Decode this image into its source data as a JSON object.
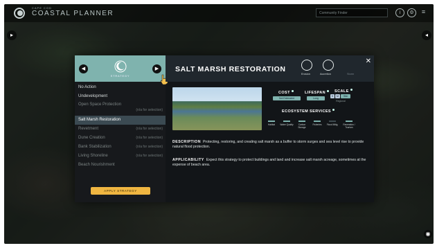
{
  "app": {
    "logo_small": "CAPE COD",
    "logo_big": "COASTAL PLANNER",
    "search_placeholder": "Community Finder",
    "header_icons": [
      "info-icon",
      "settings-icon",
      "menu-icon"
    ]
  },
  "modal": {
    "strategy_label": "STRATEGY",
    "title": "SALT MARSH RESTORATION",
    "header_icons": [
      {
        "icon": "erosion-icon",
        "label": "Erosion"
      },
      {
        "icon": "accretion-icon",
        "label": "Accretion"
      },
      {
        "icon": "storm-icon",
        "label": "Storm"
      }
    ],
    "strategies": [
      {
        "label": "No Action",
        "note": ""
      },
      {
        "label": "Undevelopment",
        "note": ""
      },
      {
        "label": "Open Space Protection",
        "note": "(n/a for selection)"
      },
      {
        "label": "Salt Marsh Restoration",
        "note": "",
        "selected": true
      },
      {
        "label": "Revetment",
        "note": "(n/a for selection)"
      },
      {
        "label": "Dune Creation",
        "note": "(n/a for selection)"
      },
      {
        "label": "Bank Stabilization",
        "note": "(n/a for selection)"
      },
      {
        "label": "Living Shoreline",
        "note": "(n/a for selection)"
      },
      {
        "label": "Beach Nourishment",
        "note": ""
      }
    ],
    "apply_label": "APPLY STRATEGY",
    "stats": {
      "cost_label": "COST",
      "cost_value": "Not Estimated",
      "lifespan_label": "LIFESPAN",
      "lifespan_value": "Long",
      "scale_label": "SCALE",
      "scale_values": [
        "S",
        "M",
        "Site",
        "Regional"
      ],
      "ecosystem_label": "ECOSYSTEM SERVICES",
      "ecosystem_items": [
        "Habitat",
        "Water Quality",
        "Carbon Storage",
        "Fisheries",
        "Flood Mitig.",
        "Recreation / Tourism"
      ]
    },
    "description_label": "DESCRIPTION",
    "description_text": "Protecting, restoring, and creating salt marsh as a buffer to storm surges and sea level rise to provide natural flood protection.",
    "applicability_label": "APPLICABILITY",
    "applicability_text": "Expect this strategy to protect buildings and land and increase salt marsh acreage, sometimes at the expense of beach area."
  },
  "colors": {
    "accent": "#7fb3ae",
    "apply_button": "#f0b641",
    "selected_row": "#3b4a52"
  }
}
